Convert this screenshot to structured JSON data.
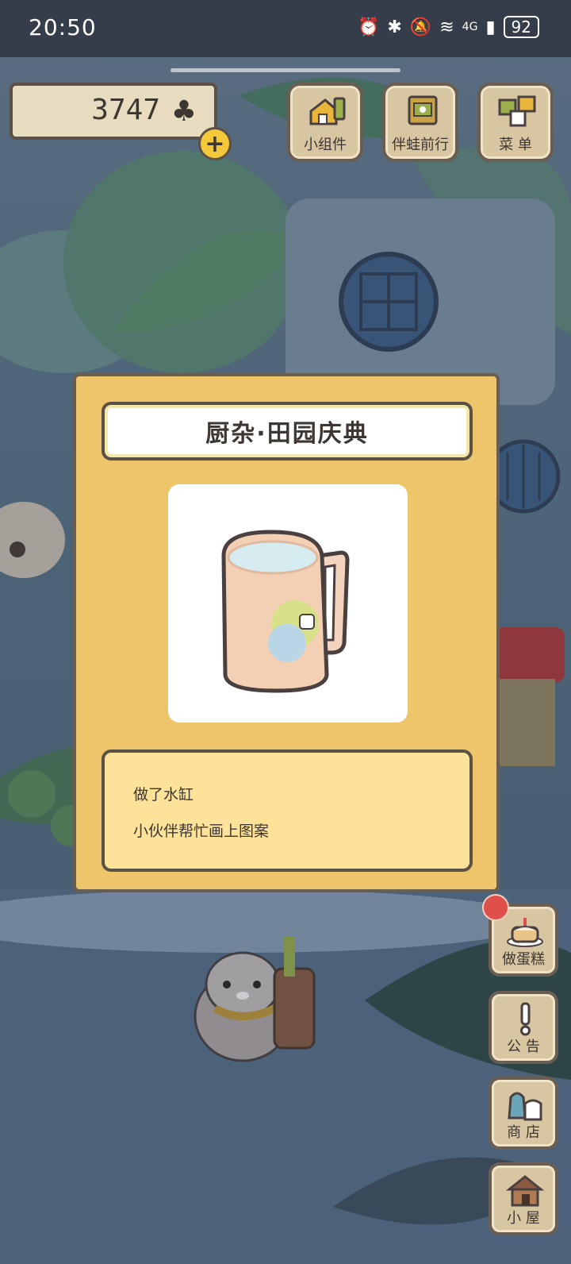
{
  "status_bar": {
    "time": "20:50",
    "network": "4G",
    "battery": "92"
  },
  "currency": {
    "value": "3747",
    "icon": "clover-icon",
    "add_label": "+"
  },
  "top_buttons": [
    {
      "label": "小组件",
      "icon": "widget-icon"
    },
    {
      "label": "伴蛙前行",
      "icon": "journey-icon"
    },
    {
      "label": "菜 单",
      "icon": "menu-icon"
    }
  ],
  "side_buttons": [
    {
      "label": "做蛋糕",
      "icon": "cake-icon",
      "badge": true
    },
    {
      "label": "公 告",
      "icon": "exclamation-icon"
    },
    {
      "label": "商 店",
      "icon": "shop-bag-icon"
    },
    {
      "label": "小 屋",
      "icon": "house-icon"
    }
  ],
  "dialog": {
    "title": "厨杂·田园庆典",
    "item_icon": "painted-mug-icon",
    "desc_lines": [
      "做了水缸",
      "小伙伴帮忙画上图案"
    ]
  },
  "colors": {
    "dialog_bg": "#eec56a",
    "desc_bg": "#fde29a",
    "button_bg": "#d8c6a2",
    "border": "#6a5e52",
    "badge": "#e0504a"
  }
}
